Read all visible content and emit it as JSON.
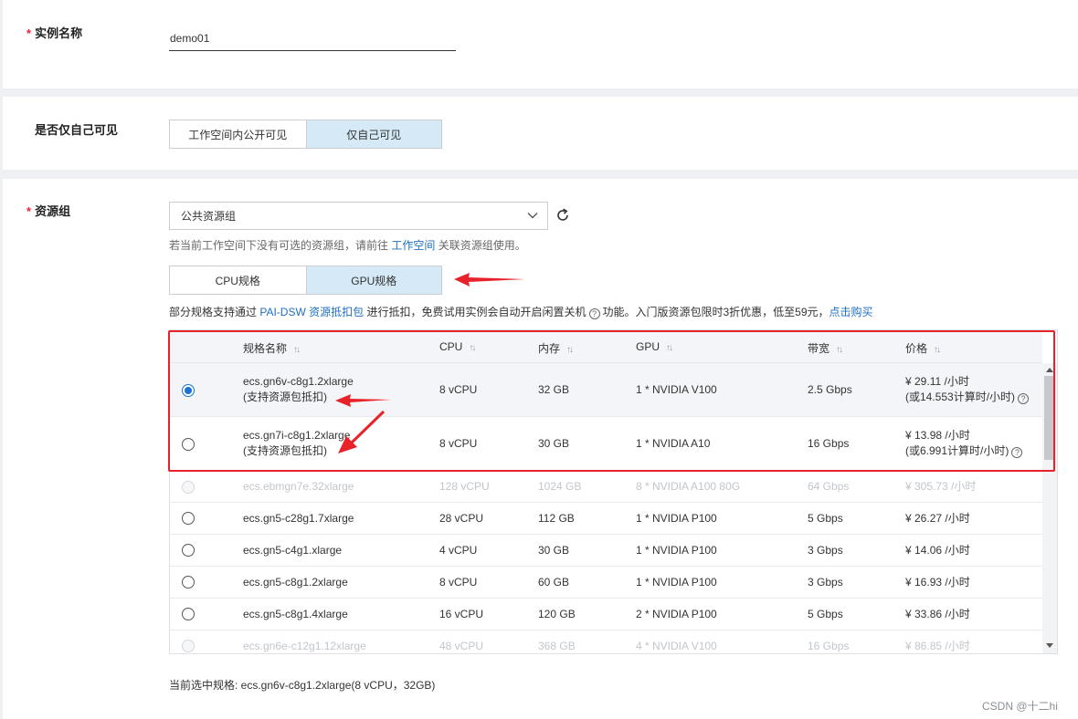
{
  "instance_name": {
    "label": "实例名称",
    "value": "demo01"
  },
  "visibility": {
    "label": "是否仅自己可见",
    "options": [
      "工作空间内公开可见",
      "仅自己可见"
    ],
    "selected": "仅自己可见"
  },
  "resource_group": {
    "label": "资源组",
    "selected": "公共资源组",
    "hint_prefix": "若当前工作空间下没有可选的资源组，请前往",
    "hint_link": "工作空间",
    "hint_suffix": "关联资源组使用。",
    "spec_tabs": [
      "CPU规格",
      "GPU规格"
    ],
    "selected_tab": "GPU规格",
    "promo": {
      "prefix": "部分规格支持通过",
      "link1": "PAI-DSW 资源抵扣包",
      "middle": "进行抵扣，免费试用实例会自动开启闲置关机",
      "after_icon": "功能。入门版资源包限时3折优惠，低至59元，",
      "link2": "点击购买"
    }
  },
  "spec_table": {
    "columns": [
      "规格名称",
      "CPU",
      "内存",
      "GPU",
      "带宽",
      "价格"
    ],
    "rows": [
      {
        "name": "ecs.gn6v-c8g1.2xlarge",
        "note": "(支持资源包抵扣)",
        "cpu": "8 vCPU",
        "memory": "32 GB",
        "gpu": "1 * NVIDIA V100",
        "bandwidth": "2.5 Gbps",
        "price": "¥ 29.11 /小时",
        "price_note": "(或14.553计算时/小时)",
        "selected": true,
        "disabled": false
      },
      {
        "name": "ecs.gn7i-c8g1.2xlarge",
        "note": "(支持资源包抵扣)",
        "cpu": "8 vCPU",
        "memory": "30 GB",
        "gpu": "1 * NVIDIA A10",
        "bandwidth": "16 Gbps",
        "price": "¥ 13.98 /小时",
        "price_note": "(或6.991计算时/小时)",
        "selected": false,
        "disabled": false
      },
      {
        "name": "ecs.ebmgn7e.32xlarge",
        "cpu": "128 vCPU",
        "memory": "1024 GB",
        "gpu": "8 * NVIDIA A100 80G",
        "bandwidth": "64 Gbps",
        "price": "¥ 305.73 /小时",
        "selected": false,
        "disabled": true
      },
      {
        "name": "ecs.gn5-c28g1.7xlarge",
        "cpu": "28 vCPU",
        "memory": "112 GB",
        "gpu": "1 * NVIDIA P100",
        "bandwidth": "5 Gbps",
        "price": "¥ 26.27 /小时",
        "selected": false,
        "disabled": false
      },
      {
        "name": "ecs.gn5-c4g1.xlarge",
        "cpu": "4 vCPU",
        "memory": "30 GB",
        "gpu": "1 * NVIDIA P100",
        "bandwidth": "3 Gbps",
        "price": "¥ 14.06 /小时",
        "selected": false,
        "disabled": false
      },
      {
        "name": "ecs.gn5-c8g1.2xlarge",
        "cpu": "8 vCPU",
        "memory": "60 GB",
        "gpu": "1 * NVIDIA P100",
        "bandwidth": "3 Gbps",
        "price": "¥ 16.93 /小时",
        "selected": false,
        "disabled": false
      },
      {
        "name": "ecs.gn5-c8g1.4xlarge",
        "cpu": "16 vCPU",
        "memory": "120 GB",
        "gpu": "2 * NVIDIA P100",
        "bandwidth": "5 Gbps",
        "price": "¥ 33.86 /小时",
        "selected": false,
        "disabled": false
      },
      {
        "name": "ecs.gn6e-c12g1.12xlarge",
        "cpu": "48 vCPU",
        "memory": "368 GB",
        "gpu": "4 * NVIDIA V100",
        "bandwidth": "16 Gbps",
        "price": "¥ 86.85 /小时",
        "selected": false,
        "disabled": true
      }
    ]
  },
  "current_selection": "当前选中规格: ecs.gn6v-c8g1.2xlarge(8 vCPU，32GB)",
  "watermark": "CSDN @十二hi",
  "colors": {
    "accent": "#1f6fbf",
    "annotation_red": "#e8222a",
    "selected_option_bg": "#d5e9f7"
  },
  "icons": [
    "chevron-down-icon",
    "refresh-icon",
    "sort-icon",
    "help-icon"
  ]
}
